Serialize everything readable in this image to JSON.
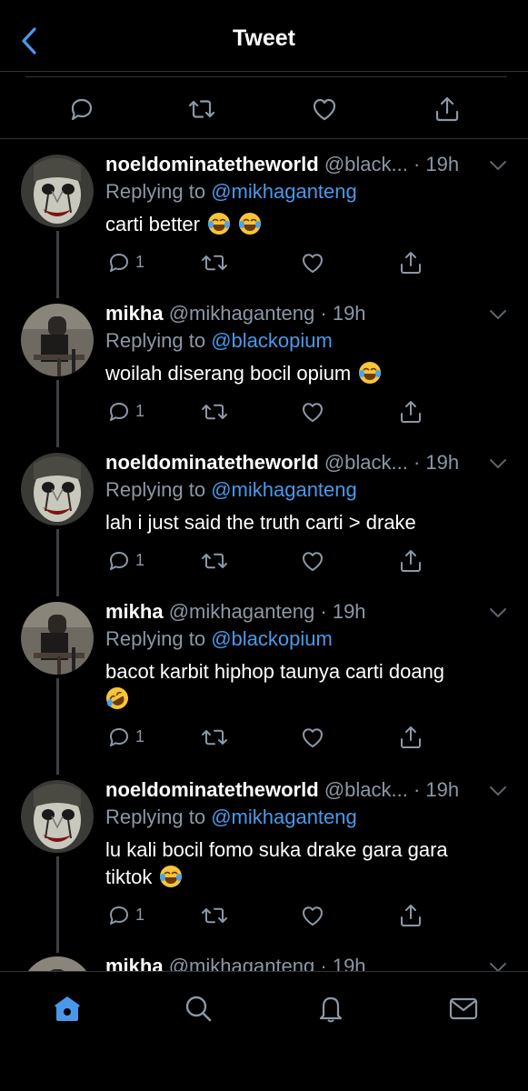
{
  "header": {
    "title": "Tweet"
  },
  "tweets": [
    {
      "name": "noeldominatetheworld",
      "handle": "@black...",
      "time": "· 19h",
      "replying_prefix": "Replying to",
      "replying_to": "@mikhaganteng",
      "text": "carti better",
      "emojis": [
        "laugh-cry",
        "laugh-cry"
      ],
      "reply_count": "1",
      "avatar": "clown"
    },
    {
      "name": "mikha",
      "handle": "@mikhaganteng",
      "time": "· 19h",
      "replying_prefix": "Replying to",
      "replying_to": "@blackopium",
      "text": "woilah diserang bocil opium",
      "emojis": [
        "laugh-cry"
      ],
      "reply_count": "1",
      "avatar": "photo"
    },
    {
      "name": "noeldominatetheworld",
      "handle": "@black...",
      "time": "· 19h",
      "replying_prefix": "Replying to",
      "replying_to": "@mikhaganteng",
      "text": "lah i just said the truth carti > drake",
      "emojis": [],
      "reply_count": "1",
      "avatar": "clown"
    },
    {
      "name": "mikha",
      "handle": "@mikhaganteng",
      "time": "· 19h",
      "replying_prefix": "Replying to",
      "replying_to": "@blackopium",
      "text": "bacot karbit hiphop taunya carti doang",
      "emojis": [
        "rofl"
      ],
      "reply_count": "1",
      "avatar": "photo"
    },
    {
      "name": "noeldominatetheworld",
      "handle": "@black...",
      "time": "· 19h",
      "replying_prefix": "Replying to",
      "replying_to": "@mikhaganteng",
      "text": "lu kali bocil fomo suka drake gara gara tiktok",
      "emojis": [
        "laugh-cry"
      ],
      "reply_count": "1",
      "avatar": "clown"
    },
    {
      "name": "mikha",
      "handle": "@mikhaganteng",
      "time": "· 19h",
      "avatar": "photo"
    }
  ],
  "tabbar": {
    "items": [
      "home-icon",
      "search-icon",
      "notifications-icon",
      "messages-icon"
    ]
  },
  "colors": {
    "accent": "#4a99e9",
    "muted": "#8b98a5",
    "background": "#000000"
  }
}
